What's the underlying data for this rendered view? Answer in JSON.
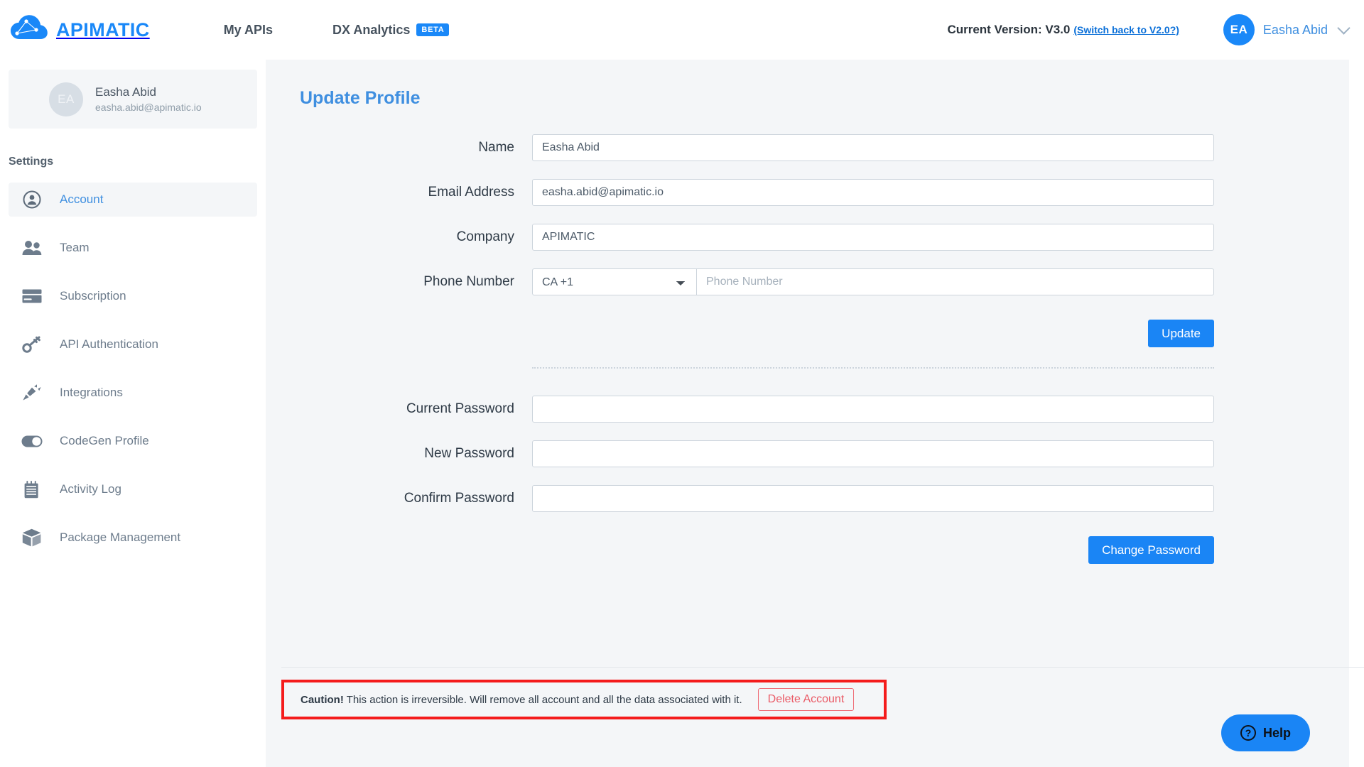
{
  "navbar": {
    "brand": "APIMATIC",
    "links": [
      {
        "label": "My APIs",
        "badge": ""
      },
      {
        "label": "DX Analytics",
        "badge": "BETA"
      }
    ],
    "version_text": "Current Version: V3.0",
    "version_switch": "(Switch back to V2.0?)",
    "user_initials": "EA",
    "user_name": "Easha Abid"
  },
  "sidebar": {
    "profile": {
      "initials": "EA",
      "name": "Easha Abid",
      "email": "easha.abid@apimatic.io"
    },
    "section_title": "Settings",
    "items": [
      {
        "label": "Account",
        "icon": "user-circle-icon",
        "active": true
      },
      {
        "label": "Team",
        "icon": "people-icon",
        "active": false
      },
      {
        "label": "Subscription",
        "icon": "credit-card-icon",
        "active": false
      },
      {
        "label": "API Authentication",
        "icon": "key-icon",
        "active": false
      },
      {
        "label": "Integrations",
        "icon": "plug-icon",
        "active": false
      },
      {
        "label": "CodeGen Profile",
        "icon": "toggle-icon",
        "active": false
      },
      {
        "label": "Activity Log",
        "icon": "notepad-icon",
        "active": false
      },
      {
        "label": "Package Management",
        "icon": "box-icon",
        "active": false
      }
    ]
  },
  "main": {
    "title": "Update Profile",
    "fields": {
      "name_label": "Name",
      "name_value": "Easha Abid",
      "email_label": "Email Address",
      "email_value": "easha.abid@apimatic.io",
      "company_label": "Company",
      "company_value": "APIMATIC",
      "phone_label": "Phone Number",
      "phone_country": "CA +1",
      "phone_placeholder": "Phone Number",
      "current_password_label": "Current Password",
      "current_password_value": "",
      "new_password_label": "New Password",
      "new_password_value": "",
      "confirm_password_label": "Confirm Password",
      "confirm_password_value": ""
    },
    "update_button": "Update",
    "change_password_button": "Change Password",
    "caution": {
      "prefix": "Caution!",
      "message": " This action is irreversible. Will remove all account and all the data associated with it.",
      "delete_button": "Delete Account",
      "border_color": "#f41c1c"
    }
  },
  "help": {
    "label": "Help",
    "icon": "question-mark-icon"
  },
  "colors": {
    "brand_blue": "#1a88f8",
    "link_blue": "#3f8fe0",
    "primary_button": "#1a85f5",
    "danger_red": "#ea5a66",
    "panel_bg": "#f4f6f8"
  }
}
